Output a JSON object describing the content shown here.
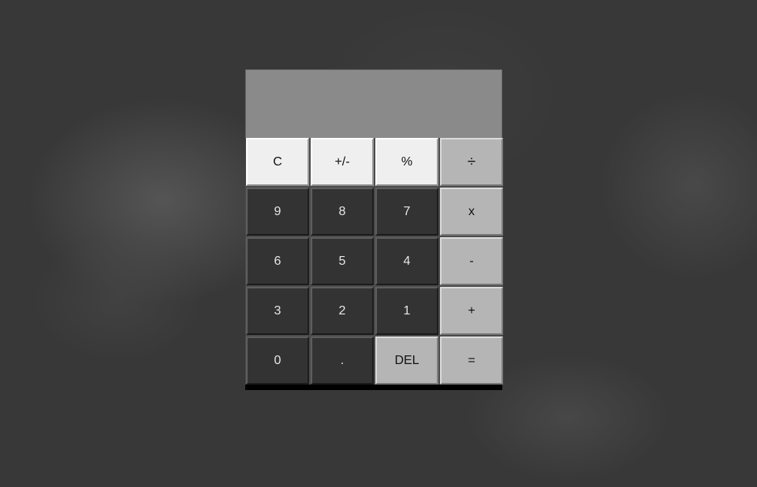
{
  "display": {
    "value": ""
  },
  "keys": {
    "clear": "C",
    "plus_minus": "+/-",
    "percent": "%",
    "divide": "÷",
    "nine": "9",
    "eight": "8",
    "seven": "7",
    "multiply": "x",
    "six": "6",
    "five": "5",
    "four": "4",
    "subtract": "-",
    "three": "3",
    "two": "2",
    "one": "1",
    "add": "+",
    "zero": "0",
    "decimal": ".",
    "delete": "DEL",
    "equals": "="
  },
  "colors": {
    "background": "#383838",
    "display": "#8a8a8a",
    "function_key": "#efefef",
    "number_key": "#333333",
    "operator_key": "#b5b5b5"
  }
}
